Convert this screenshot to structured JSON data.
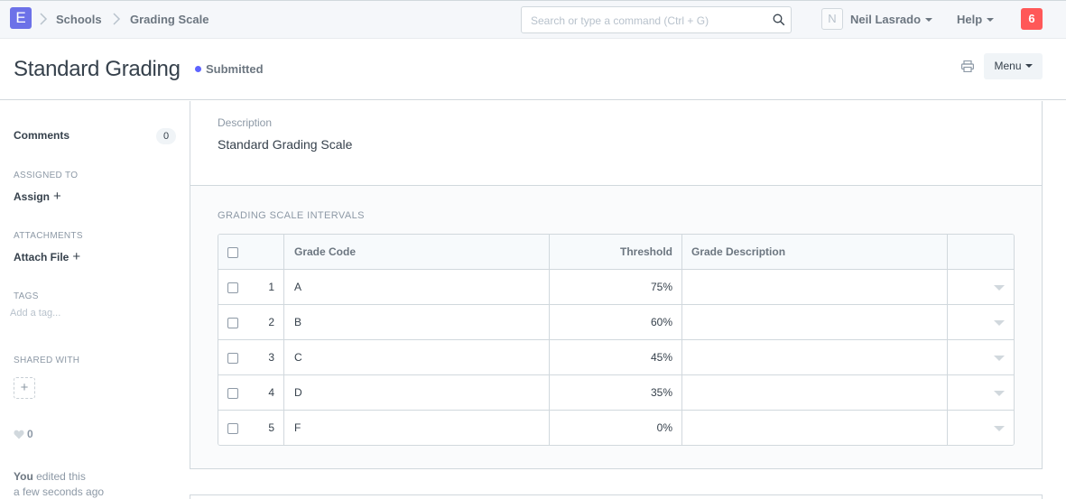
{
  "navbar": {
    "logo": "E",
    "breadcrumbs": [
      "Schools",
      "Grading Scale"
    ],
    "search_placeholder": "Search or type a command (Ctrl + G)",
    "user_initial": "N",
    "user_name": "Neil Lasrado",
    "help_label": "Help",
    "notification_count": "6"
  },
  "page": {
    "title": "Standard Grading",
    "status": "Submitted",
    "status_color": "#5e64ff",
    "menu_label": "Menu"
  },
  "sidebar": {
    "comments_label": "Comments",
    "comments_count": "0",
    "assigned_to_label": "ASSIGNED TO",
    "assign_action": "Assign",
    "attachments_label": "ATTACHMENTS",
    "attach_action": "Attach File",
    "tags_label": "TAGS",
    "tag_placeholder": "Add a tag...",
    "shared_with_label": "SHARED WITH",
    "likes": "0",
    "activity_user": "You",
    "activity_text": "edited this",
    "activity_time": "a few seconds ago"
  },
  "form": {
    "description_label": "Description",
    "description_value": "Standard Grading Scale",
    "grid_label": "GRADING SCALE INTERVALS",
    "columns": [
      "Grade Code",
      "Threshold",
      "Grade Description"
    ],
    "rows": [
      {
        "idx": "1",
        "grade_code": "A",
        "threshold": "75%",
        "grade_description": ""
      },
      {
        "idx": "2",
        "grade_code": "B",
        "threshold": "60%",
        "grade_description": ""
      },
      {
        "idx": "3",
        "grade_code": "C",
        "threshold": "45%",
        "grade_description": ""
      },
      {
        "idx": "4",
        "grade_code": "D",
        "threshold": "35%",
        "grade_description": ""
      },
      {
        "idx": "5",
        "grade_code": "F",
        "threshold": "0%",
        "grade_description": ""
      }
    ]
  }
}
